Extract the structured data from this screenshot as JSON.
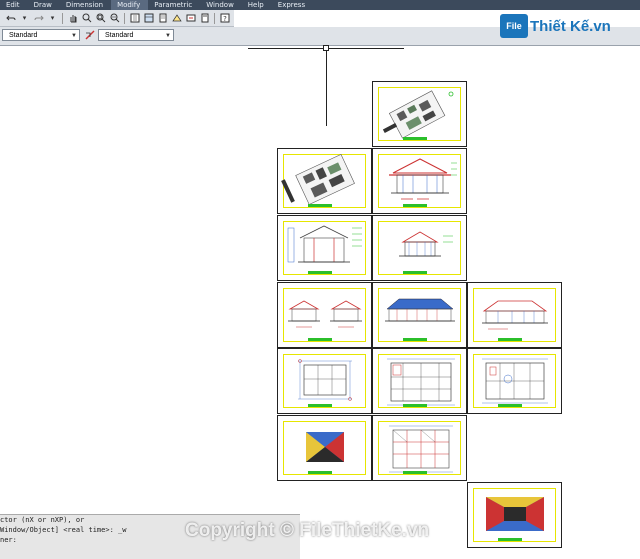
{
  "menubar": {
    "items": [
      "Edit",
      "Draw",
      "Dimension",
      "Modify",
      "Parametric",
      "Window",
      "Help",
      "Express"
    ],
    "active_index": 3
  },
  "toolbar": {
    "text_style": "Standard",
    "dim_style": "Standard"
  },
  "command_line": {
    "lines": [
      "ctor (nX or nXP), or",
      "Window/Object] <real time>: _w",
      "ner:"
    ]
  },
  "watermark": {
    "logo_mark": "File",
    "logo_text": "Thiết Kế.vn",
    "copyright": "Copyright © FileThietKe.vn"
  },
  "colors": {
    "menubar_bg": "#3c4a5c",
    "sheet_frame": "#e6e600",
    "title_strip": "#2bbf2b",
    "logo_blue": "#1b75bb"
  }
}
